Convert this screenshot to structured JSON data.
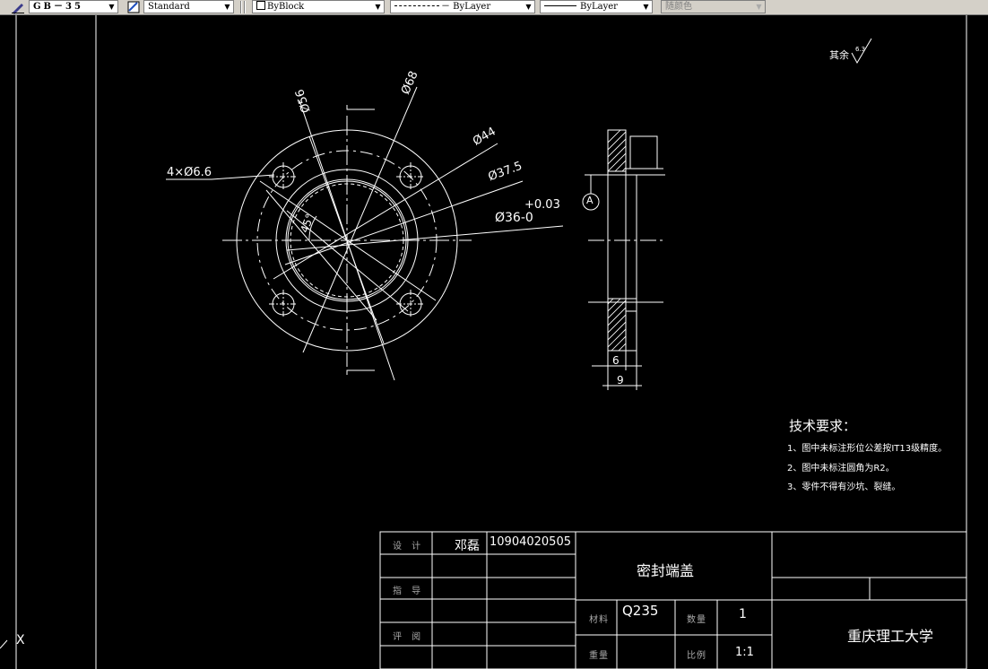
{
  "toolbar": {
    "text_style": "GB－35",
    "dim_style": "Standard",
    "layer_color": "ByBlock",
    "linetype": "－ ByLayer",
    "lineweight": "ByLayer",
    "plot_style": "随颜色"
  },
  "annotations": {
    "surface_finish": "其余",
    "surface_value": "6.3",
    "tech_title": "技术要求：",
    "tech_items": [
      "1、图中未标注形位公差按IT13级精度。",
      "2、图中未标注圆角为R2。",
      "3、零件不得有沙坑、裂缝。"
    ]
  },
  "dimensions": {
    "holes": "4×Ø6.6",
    "d56": "Ø56",
    "d68": "Ø68",
    "d44": "Ø44",
    "d37": "Ø37.5",
    "d36": "Ø36-0",
    "tol": "+0.03",
    "angle": "45°",
    "datum": "A",
    "w6": "6",
    "w9": "9"
  },
  "title_block": {
    "design_label": "设 计",
    "designer": "邓磊",
    "student_id": "10904020505",
    "check_label": "指 导",
    "review_label": "评 阅",
    "part_name": "密封端盖",
    "material_label": "材料",
    "material": "Q235",
    "qty_label": "数量",
    "qty": "1",
    "weight_label": "重量",
    "scale_label": "比例",
    "scale": "1:1",
    "school": "重庆理工大学"
  },
  "ucs": {
    "axis": "X"
  }
}
